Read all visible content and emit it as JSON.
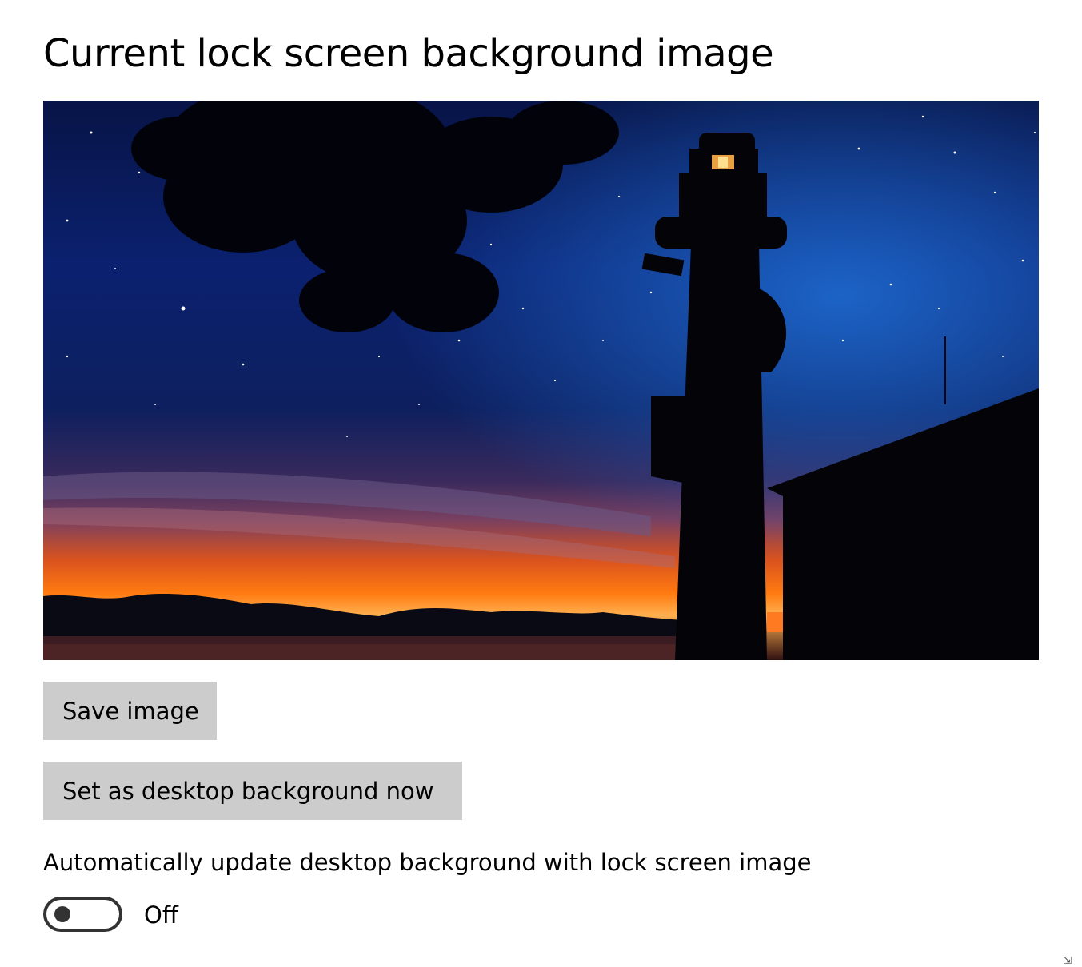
{
  "title": "Current lock screen background image",
  "preview": {
    "icon": "lighthouse-night-photo"
  },
  "buttons": {
    "save": "Save image",
    "set_desktop": "Set as desktop background now"
  },
  "auto_update": {
    "label": "Automatically update desktop background with lock screen image",
    "toggle_state": "Off",
    "enabled": false
  },
  "colors": {
    "button_bg": "#cccccc",
    "toggle_border": "#333333"
  }
}
